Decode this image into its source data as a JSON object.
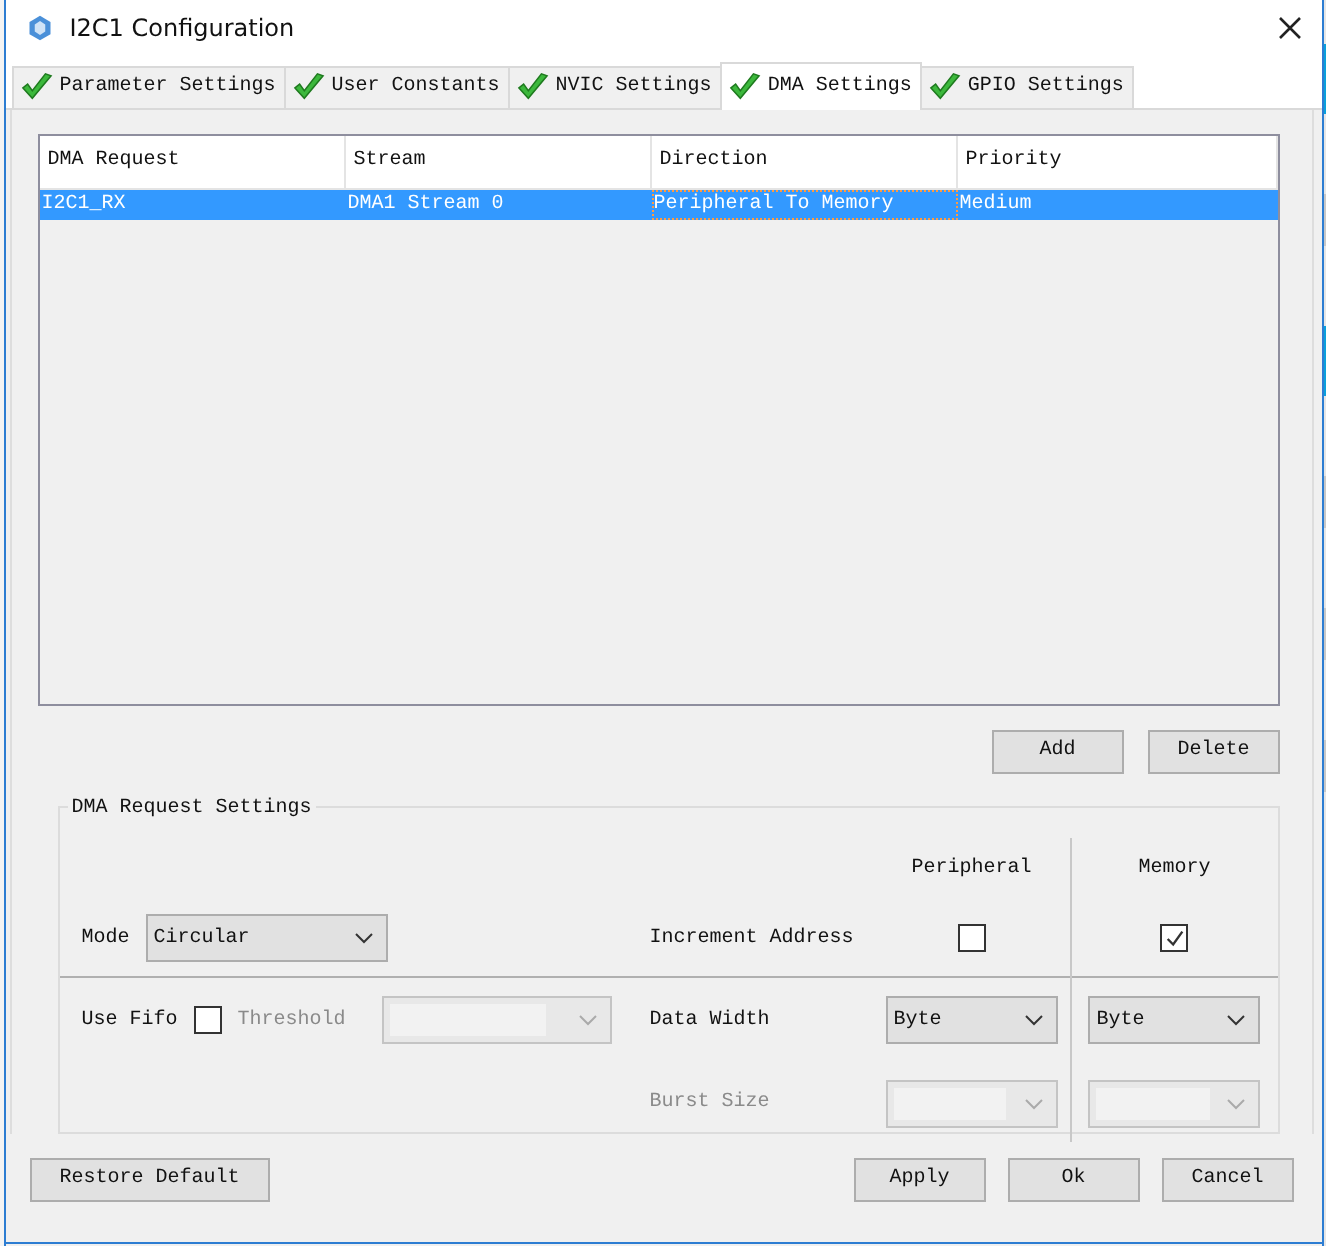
{
  "window": {
    "title": "I2C1 Configuration"
  },
  "tabs": [
    {
      "label": "Parameter Settings",
      "selected": false
    },
    {
      "label": "User Constants",
      "selected": false
    },
    {
      "label": "NVIC Settings",
      "selected": false
    },
    {
      "label": "DMA Settings",
      "selected": true
    },
    {
      "label": "GPIO Settings",
      "selected": false
    }
  ],
  "table": {
    "columns": [
      "DMA Request",
      "Stream",
      "Direction",
      "Priority"
    ],
    "rows": [
      {
        "selected": true,
        "cells": [
          {
            "text": "I2C1_RX",
            "focused": false
          },
          {
            "text": "DMA1 Stream 0",
            "focused": false
          },
          {
            "text": "Peripheral To Memory",
            "focused": true
          },
          {
            "text": "Medium",
            "focused": false
          }
        ]
      }
    ]
  },
  "table_buttons": [
    "Add",
    "Delete"
  ],
  "settings": {
    "title": "DMA Request Settings",
    "column_headers": [
      "Peripheral",
      "Memory"
    ],
    "mode": {
      "label": "Mode",
      "value": "Circular"
    },
    "increment_address": {
      "label": "Increment Address",
      "peripheral_checked": false,
      "memory_checked": true
    },
    "use_fifo": {
      "label": "Use Fifo",
      "checked": false
    },
    "threshold": {
      "label": "Threshold",
      "disabled": true
    },
    "data_width": {
      "label": "Data Width",
      "peripheral": "Byte",
      "memory": "Byte",
      "disabled": false
    },
    "burst_size": {
      "label": "Burst Size",
      "disabled": true
    }
  },
  "footer": {
    "restore": "Restore Default",
    "buttons": [
      "Apply",
      "Ok",
      "Cancel"
    ]
  }
}
